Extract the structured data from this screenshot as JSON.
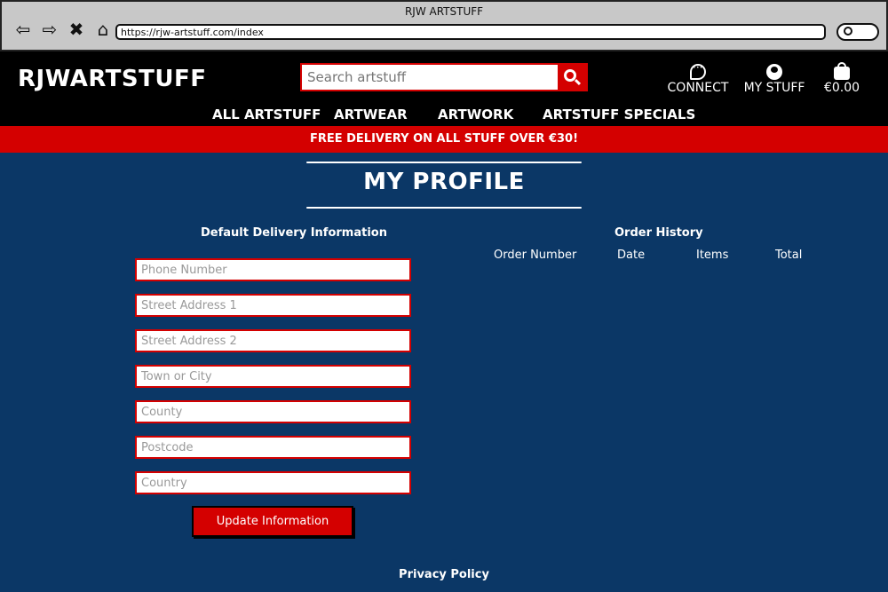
{
  "browser": {
    "window_title": "RJW ARTSTUFF",
    "url": "https://rjw-artstuff.com/index",
    "icons": [
      "back-arrow-icon",
      "forward-arrow-icon",
      "close-x-icon",
      "home-icon",
      "search-icon"
    ]
  },
  "header": {
    "logo": "RJWARTSTUFF",
    "search_placeholder": "Search artstuff",
    "links": {
      "connect": "CONNECT",
      "my_stuff": "MY STUFF",
      "basket_total": "€0.00"
    }
  },
  "nav": {
    "items": [
      "ALL ARTSTUFF",
      "ARTWEAR",
      "ARTWORK",
      "ARTSTUFF SPECIALS"
    ]
  },
  "banner": {
    "text": "FREE DELIVERY ON ALL STUFF OVER €30!"
  },
  "page": {
    "title": "MY PROFILE"
  },
  "delivery": {
    "heading": "Default Delivery Information",
    "fields": [
      {
        "placeholder": "Phone Number",
        "value": ""
      },
      {
        "placeholder": "Street Address 1",
        "value": ""
      },
      {
        "placeholder": "Street Address 2",
        "value": ""
      },
      {
        "placeholder": "Town or City",
        "value": ""
      },
      {
        "placeholder": "County",
        "value": ""
      },
      {
        "placeholder": "Postcode",
        "value": ""
      },
      {
        "placeholder": "Country",
        "value": ""
      }
    ],
    "button_label": "Update Information"
  },
  "orders": {
    "heading": "Order History",
    "columns": [
      "Order Number",
      "Date",
      "Items",
      "Total"
    ],
    "rows": []
  },
  "footer": {
    "privacy_link": "Privacy Policy"
  },
  "colors": {
    "accent_red": "#d40000",
    "page_blue": "#0b3766",
    "header_black": "#000000"
  }
}
